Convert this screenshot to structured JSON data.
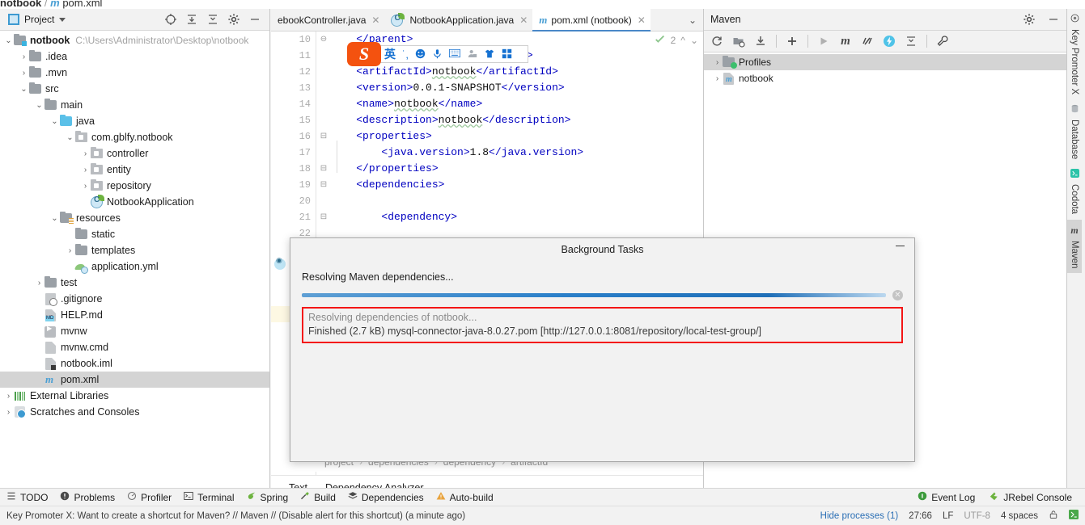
{
  "window": {
    "breadcrumb_project": "notbook",
    "breadcrumb_sep": "/",
    "breadcrumb_file": "pom.xml"
  },
  "project_panel": {
    "title": "Project",
    "title_icon": "project-window-icon",
    "dropdown_icon": "chevron-down-icon",
    "actions": [
      {
        "name": "select-opened-file-icon",
        "glyph": "⊕"
      },
      {
        "name": "expand-all-icon",
        "glyph": "⤓"
      },
      {
        "name": "collapse-all-icon",
        "glyph": "⤒"
      },
      {
        "name": "settings-gear-icon",
        "glyph": "⚙"
      },
      {
        "name": "hide-panel-icon",
        "glyph": "─"
      }
    ],
    "tree": [
      {
        "label": "notbook",
        "path": "C:\\Users\\Administrator\\Desktop\\notbook",
        "indent": 0,
        "arrow": "v",
        "icon": "module-folder-icon",
        "bold": true
      },
      {
        "label": ".idea",
        "path": "",
        "indent": 1,
        "arrow": ">",
        "icon": "folder-icon",
        "bold": false
      },
      {
        "label": ".mvn",
        "path": "",
        "indent": 1,
        "arrow": ">",
        "icon": "folder-icon",
        "bold": false
      },
      {
        "label": "src",
        "path": "",
        "indent": 1,
        "arrow": "v",
        "icon": "folder-icon",
        "bold": false
      },
      {
        "label": "main",
        "path": "",
        "indent": 2,
        "arrow": "v",
        "icon": "folder-icon",
        "bold": false
      },
      {
        "label": "java",
        "path": "",
        "indent": 3,
        "arrow": "v",
        "icon": "source-root-icon",
        "bold": false
      },
      {
        "label": "com.gblfy.notbook",
        "path": "",
        "indent": 4,
        "arrow": "v",
        "icon": "package-icon",
        "bold": false
      },
      {
        "label": "controller",
        "path": "",
        "indent": 5,
        "arrow": ">",
        "icon": "package-icon",
        "bold": false
      },
      {
        "label": "entity",
        "path": "",
        "indent": 5,
        "arrow": ">",
        "icon": "package-icon",
        "bold": false
      },
      {
        "label": "repository",
        "path": "",
        "indent": 5,
        "arrow": ">",
        "icon": "package-icon",
        "bold": false
      },
      {
        "label": "NotbookApplication",
        "path": "",
        "indent": 5,
        "arrow": "",
        "icon": "spring-boot-class-icon",
        "bold": false
      },
      {
        "label": "resources",
        "path": "",
        "indent": 3,
        "arrow": "v",
        "icon": "resources-root-icon",
        "bold": false
      },
      {
        "label": "static",
        "path": "",
        "indent": 4,
        "arrow": "",
        "icon": "folder-icon",
        "bold": false
      },
      {
        "label": "templates",
        "path": "",
        "indent": 4,
        "arrow": ">",
        "icon": "folder-icon",
        "bold": false
      },
      {
        "label": "application.yml",
        "path": "",
        "indent": 4,
        "arrow": "",
        "icon": "spring-yaml-icon",
        "bold": false
      },
      {
        "label": "test",
        "path": "",
        "indent": 2,
        "arrow": ">",
        "icon": "folder-icon",
        "bold": false
      },
      {
        "label": ".gitignore",
        "path": "",
        "indent": 2,
        "arrow": "",
        "icon": "gitignore-file-icon",
        "bold": false
      },
      {
        "label": "HELP.md",
        "path": "",
        "indent": 2,
        "arrow": "",
        "icon": "markdown-file-icon",
        "bold": false
      },
      {
        "label": "mvnw",
        "path": "",
        "indent": 2,
        "arrow": "",
        "icon": "shell-script-icon",
        "bold": false
      },
      {
        "label": "mvnw.cmd",
        "path": "",
        "indent": 2,
        "arrow": "",
        "icon": "cmd-script-icon",
        "bold": false
      },
      {
        "label": "notbook.iml",
        "path": "",
        "indent": 2,
        "arrow": "",
        "icon": "iml-file-icon",
        "bold": false
      },
      {
        "label": "pom.xml",
        "path": "",
        "indent": 2,
        "arrow": "",
        "icon": "maven-pom-icon",
        "bold": false,
        "selected": true
      },
      {
        "label": "External Libraries",
        "path": "",
        "indent": 0,
        "arrow": ">",
        "icon": "external-libraries-icon",
        "bold": false
      },
      {
        "label": "Scratches and Consoles",
        "path": "",
        "indent": 0,
        "arrow": ">",
        "icon": "scratches-icon",
        "bold": false
      }
    ]
  },
  "editor": {
    "tabs": [
      {
        "label": "ebookController.java",
        "icon": "java-class-icon",
        "active": false,
        "closable": true
      },
      {
        "label": "NotbookApplication.java",
        "icon": "spring-boot-class-icon",
        "active": false,
        "closable": true
      },
      {
        "label": "pom.xml (notbook)",
        "icon": "maven-pom-icon",
        "active": true,
        "closable": true
      }
    ],
    "tab_overflow_icon": "chevron-down-icon",
    "inspection": {
      "count": "2",
      "up_icon": "chevron-up-icon",
      "down_icon": "chevron-down-icon",
      "status_icon": "inspection-ok-icon"
    },
    "first_line_number": 10,
    "current_line": 27,
    "lines": [
      {
        "n": 10,
        "text": "    </parent>",
        "fold": "⊖"
      },
      {
        "n": 11,
        "text": "    <groupId>com.gblfy</groupId>",
        "fold": ""
      },
      {
        "n": 12,
        "text": "    <artifactId>notbook</artifactId>",
        "fold": ""
      },
      {
        "n": 13,
        "text": "    <version>0.0.1-SNAPSHOT</version>",
        "fold": ""
      },
      {
        "n": 14,
        "text": "    <name>notbook</name>",
        "fold": ""
      },
      {
        "n": 15,
        "text": "    <description>notbook</description>",
        "fold": ""
      },
      {
        "n": 16,
        "text": "    <properties>",
        "fold": "⊟"
      },
      {
        "n": 17,
        "text": "        <java.version>1.8</java.version>",
        "fold": ""
      },
      {
        "n": 18,
        "text": "    </properties>",
        "fold": "⊟"
      },
      {
        "n": 19,
        "text": "    <dependencies>",
        "fold": "⊟"
      },
      {
        "n": 20,
        "text": "",
        "fold": ""
      },
      {
        "n": 21,
        "text": "        <dependency>",
        "fold": "⊟"
      },
      {
        "n": 22,
        "text": "",
        "fold": ""
      },
      {
        "n": 23,
        "text": "",
        "fold": ""
      },
      {
        "n": 24,
        "text": "",
        "fold": ""
      },
      {
        "n": 25,
        "text": "",
        "fold": ""
      },
      {
        "n": 26,
        "text": "",
        "fold": ""
      },
      {
        "n": 27,
        "text": "",
        "fold": ""
      },
      {
        "n": 28,
        "text": "",
        "fold": ""
      },
      {
        "n": 29,
        "text": "",
        "fold": ""
      },
      {
        "n": 30,
        "text": "",
        "fold": ""
      },
      {
        "n": 31,
        "text": "",
        "fold": ""
      },
      {
        "n": 32,
        "text": "",
        "fold": ""
      },
      {
        "n": 33,
        "text": "",
        "fold": ""
      }
    ],
    "breadcrumb": [
      "project",
      "dependencies",
      "dependency",
      "artifactId"
    ],
    "bottom_tabs": [
      {
        "label": "Text",
        "active": true
      },
      {
        "label": "Dependency Analyzer",
        "active": false
      }
    ]
  },
  "maven_panel": {
    "title": "Maven",
    "header_actions": [
      {
        "name": "settings-gear-icon",
        "glyph": "⚙"
      },
      {
        "name": "hide-panel-icon",
        "glyph": "─"
      }
    ],
    "toolbar": [
      {
        "name": "reload-projects-icon",
        "glyph": "⟳"
      },
      {
        "name": "generate-sources-icon",
        "glyph": "Ὄ1"
      },
      {
        "name": "download-sources-icon",
        "glyph": "⤓"
      },
      {
        "name": "add-maven-project-icon",
        "glyph": "+"
      },
      {
        "name": "run-maven-build-icon",
        "glyph": "▶"
      },
      {
        "name": "execute-maven-goal-icon",
        "glyph": "m"
      },
      {
        "name": "toggle-skip-tests-icon",
        "glyph": "≠"
      },
      {
        "name": "toggle-offline-mode-icon",
        "glyph": "⚡"
      },
      {
        "name": "collapse-all-icon",
        "glyph": "⤒"
      },
      {
        "name": "maven-settings-icon",
        "glyph": "ὒ7"
      }
    ],
    "tree": [
      {
        "label": "Profiles",
        "arrow": ">",
        "icon": "profiles-folder-icon",
        "selected": true
      },
      {
        "label": "notbook",
        "arrow": ">",
        "icon": "maven-project-icon",
        "selected": false
      }
    ]
  },
  "right_rail": [
    {
      "label": "Key Promoter X",
      "icon": "key-promoter-icon",
      "active": false
    },
    {
      "label": "Database",
      "icon": "database-icon",
      "active": false
    },
    {
      "label": "Codota",
      "icon": "codota-icon",
      "active": false
    },
    {
      "label": "Maven",
      "icon": "maven-icon",
      "active": true
    }
  ],
  "dialog": {
    "title": "Background Tasks",
    "minimize_icon": "minimize-icon",
    "task_label": "Resolving Maven dependencies...",
    "cancel_icon": "cancel-task-icon",
    "progress_percent": 88,
    "log_lines": [
      "Resolving dependencies of notbook...",
      "Finished (2.7 kB) mysql-connector-java-8.0.27.pom [http://127.0.0.1:8081/repository/local-test-group/]"
    ],
    "highlight_color": "#f41616"
  },
  "ime_toolbar": {
    "logo": "S",
    "items": [
      {
        "name": "ime-language-mode",
        "glyph": "英"
      },
      {
        "name": "ime-punctuation-toggle-icon",
        "glyph": "˙,"
      },
      {
        "name": "ime-emoji-icon",
        "glyph": "☺"
      },
      {
        "name": "ime-voice-input-icon",
        "glyph": "Ἲ4"
      },
      {
        "name": "ime-soft-keyboard-icon",
        "glyph": "⌨"
      },
      {
        "name": "ime-user-icon",
        "glyph": "὆4"
      },
      {
        "name": "ime-skin-icon",
        "glyph": "ὅ5"
      },
      {
        "name": "ime-toolbox-icon",
        "glyph": "⊞"
      }
    ]
  },
  "tool_strip": {
    "left": [
      {
        "label": "TODO",
        "icon": "todo-icon"
      },
      {
        "label": "Problems",
        "icon": "problems-icon"
      },
      {
        "label": "Profiler",
        "icon": "profiler-icon"
      },
      {
        "label": "Terminal",
        "icon": "terminal-icon"
      },
      {
        "label": "Spring",
        "icon": "spring-icon"
      },
      {
        "label": "Build",
        "icon": "build-hammer-icon"
      },
      {
        "label": "Dependencies",
        "icon": "dependencies-icon"
      },
      {
        "label": "Auto-build",
        "icon": "warning-triangle-icon"
      }
    ],
    "right": [
      {
        "label": "Event Log",
        "icon": "event-log-icon"
      },
      {
        "label": "JRebel Console",
        "icon": "jrebel-icon"
      }
    ]
  },
  "status_bar": {
    "message": "Key Promoter X: Want to create a shortcut for Maven? // Maven // (Disable alert for this shortcut) (a minute ago)",
    "hide_processes": "Hide processes (1)",
    "caret_position": "27:66",
    "line_separator": "LF",
    "encoding": "UTF-8",
    "indent": "4 spaces",
    "lock_icon": "read-only-lock-icon",
    "git_icon": "vcs-branch-icon"
  }
}
